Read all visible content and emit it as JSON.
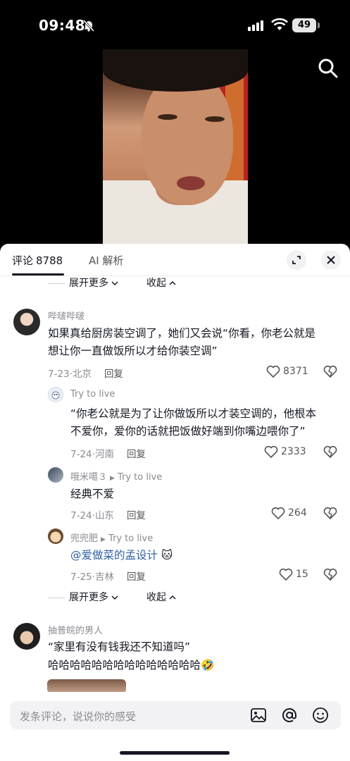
{
  "status_bar": {
    "time": "09:48",
    "battery": "49"
  },
  "tabs": {
    "comments_label": "评论",
    "comments_count": "8788",
    "ai_label": "AI 解析"
  },
  "thread_top": {
    "more_label": "展开更多",
    "collapse_label": "收起"
  },
  "comments": [
    {
      "user": "哔啵哔啵",
      "text_lines": [
        "如果真给厨房装空调了，她们又会说“你看，你老公就是",
        "想让你一直做饭所以才给你装空调”"
      ],
      "date": "7-23",
      "location": "北京",
      "reply_label": "回复",
      "likes": "8371"
    }
  ],
  "replies": [
    {
      "user": "Try to live",
      "text_lines": [
        "“你老公就是为了让你做饭所以才装空调的，他根本",
        "不爱你，爱你的话就把饭做好端到你嘴边喂你了”"
      ],
      "date": "7-24",
      "location": "河南",
      "reply_label": "回复",
      "likes": "2333"
    },
    {
      "user": "哦米噶３",
      "reply_to": "Try to live",
      "text": "经典不爱",
      "date": "7-24",
      "location": "山东",
      "reply_label": "回复",
      "likes": "264"
    },
    {
      "user": "兜兜肥",
      "reply_to": "Try to live",
      "mention": "@爱做菜的孟设计",
      "emoji": "🐱",
      "date": "7-25",
      "location": "吉林",
      "reply_label": "回复",
      "likes": "15"
    }
  ],
  "thread_bottom": {
    "more_label": "展开更多",
    "collapse_label": "收起"
  },
  "comment2": {
    "user": "抽普皖的男人",
    "text_line1": "“家里有没有钱我还不知道吗”",
    "text_line2": "哈哈哈哈哈哈哈哈哈哈哈哈哈哈",
    "emoji": "🤣"
  },
  "input": {
    "placeholder": "发条评论，说说你的感受"
  },
  "colors": {
    "mention": "#2f5fa8",
    "text": "#161823",
    "muted": "#8a8b91"
  }
}
